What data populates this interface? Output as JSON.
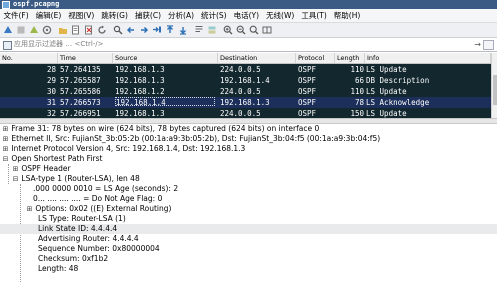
{
  "window": {
    "title": "ospf.pcapng"
  },
  "menu": [
    "文件(F)",
    "编辑(E)",
    "视图(V)",
    "跳转(G)",
    "捕获(C)",
    "分析(A)",
    "统计(S)",
    "电话(Y)",
    "无线(W)",
    "工具(T)",
    "帮助(H)"
  ],
  "filter": {
    "placeholder": "应用显示过滤器 … <Ctrl-/>",
    "arrow": "→"
  },
  "columns": {
    "no": "No.",
    "time": "Time",
    "source": "Source",
    "destination": "Destination",
    "protocol": "Protocol",
    "length": "Length",
    "info": "Info"
  },
  "packets": [
    {
      "no": "28",
      "time": "57.264135",
      "source": "192.168.1.3",
      "destination": "224.0.0.5",
      "protocol": "OSPF",
      "length": "110",
      "info": "LS Update"
    },
    {
      "no": "29",
      "time": "57.265587",
      "source": "192.168.1.3",
      "destination": "192.168.1.4",
      "protocol": "OSPF",
      "length": "66",
      "info": "DB Description"
    },
    {
      "no": "30",
      "time": "57.265586",
      "source": "192.168.1.2",
      "destination": "224.0.0.5",
      "protocol": "OSPF",
      "length": "110",
      "info": "LS Update"
    },
    {
      "no": "31",
      "time": "57.266573",
      "source": "192.168.1.4",
      "destination": "192.168.1.3",
      "protocol": "OSPF",
      "length": "78",
      "info": "LS Acknowledge"
    },
    {
      "no": "32",
      "time": "57.266951",
      "source": "192.168.1.3",
      "destination": "224.0.0.5",
      "protocol": "OSPF",
      "length": "150",
      "info": "LS Update"
    }
  ],
  "details": {
    "frame": "Frame 31: 78 bytes on wire (624 bits), 78 bytes captured (624 bits) on interface 0",
    "ethernet": "Ethernet II, Src: FujianSt_3b:05:2b (00:1a:a9:3b:05:2b), Dst: FujianSt_3b:04:f5 (00:1a:a9:3b:04:f5)",
    "ip": "Internet Protocol Version 4, Src: 192.168.1.4, Dst: 192.168.1.3",
    "ospf": "Open Shortest Path First",
    "ospf_header": "OSPF Header",
    "lsa": "LSA-type 1 (Router-LSA), len 48",
    "ls_age": ".000 0000 0010 = LS Age (seconds): 2",
    "dna": "0... .... .... .... = Do Not Age Flag: 0",
    "options": "Options: 0x02 ((E) External Routing)",
    "ls_type": "LS Type: Router-LSA (1)",
    "link_state_id": "Link State ID: 4.4.4.4",
    "adv_router": "Advertising Router: 4.4.4.4",
    "seq": "Sequence Number: 0x80000004",
    "checksum": "Checksum: 0xf1b2",
    "length": "Length: 48"
  },
  "tree": {
    "expand": "⊞",
    "collapse": "⊟",
    "leaf_pad": ""
  }
}
